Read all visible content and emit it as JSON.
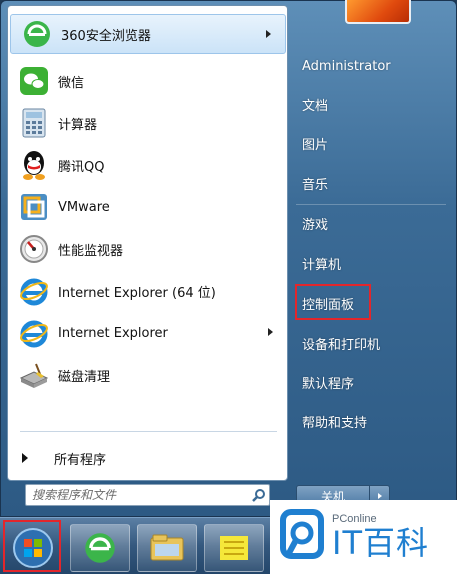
{
  "programs": [
    {
      "label": "360安全浏览器",
      "icon": "360-browser-icon",
      "has_submenu": true
    },
    {
      "label": "微信",
      "icon": "wechat-icon",
      "has_submenu": false
    },
    {
      "label": "计算器",
      "icon": "calculator-icon",
      "has_submenu": false
    },
    {
      "label": "腾讯QQ",
      "icon": "qq-icon",
      "has_submenu": false
    },
    {
      "label": "VMware",
      "icon": "vmware-icon",
      "has_submenu": false
    },
    {
      "label": "性能监视器",
      "icon": "performance-monitor-icon",
      "has_submenu": false
    },
    {
      "label": "Internet Explorer (64 位)",
      "icon": "ie-icon",
      "has_submenu": false
    },
    {
      "label": "Internet Explorer",
      "icon": "ie-icon",
      "has_submenu": true
    },
    {
      "label": "磁盘清理",
      "icon": "disk-cleanup-icon",
      "has_submenu": false
    }
  ],
  "all_programs_label": "所有程序",
  "search": {
    "placeholder": "搜索程序和文件"
  },
  "right_menu": [
    {
      "label": "Administrator"
    },
    {
      "label": "文档"
    },
    {
      "label": "图片"
    },
    {
      "label": "音乐"
    },
    {
      "label": "游戏"
    },
    {
      "label": "计算机"
    },
    {
      "label": "控制面板"
    },
    {
      "label": "设备和打印机"
    },
    {
      "label": "默认程序"
    },
    {
      "label": "帮助和支持"
    }
  ],
  "shutdown_label": "关机",
  "watermark": {
    "brand_small": "PConline",
    "brand_big": "IT百科"
  },
  "colors": {
    "highlight_red": "#e3262b",
    "brand_blue": "#1f7fd0"
  }
}
